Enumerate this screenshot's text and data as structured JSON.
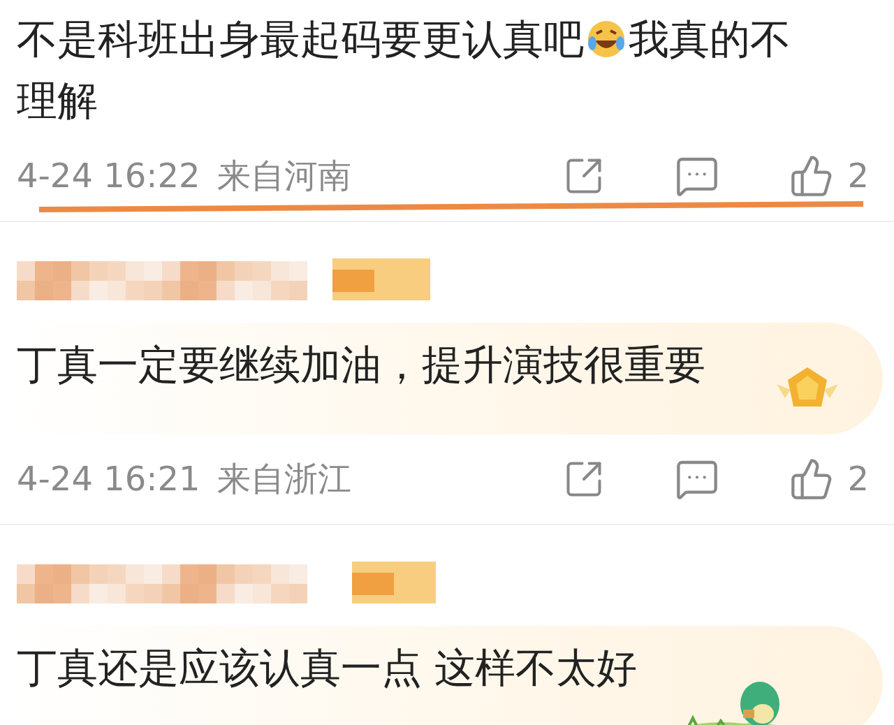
{
  "comments": [
    {
      "kind": "plain",
      "text_parts": [
        "不是科班出身最起码要更认真吧",
        "我真的不理解"
      ],
      "meta": {
        "time": "4-24 16:22",
        "location": "来自河南",
        "struck": true
      },
      "likes": "2"
    },
    {
      "kind": "medal",
      "text_parts": [
        "丁真一定要继续加油，提升演技很重要"
      ],
      "meta": {
        "time": "4-24 16:21",
        "location": "来自浙江",
        "struck": false
      },
      "likes": "2"
    },
    {
      "kind": "dino",
      "text_parts": [
        "丁真还是应该认真一点 这样不太好"
      ]
    }
  ]
}
